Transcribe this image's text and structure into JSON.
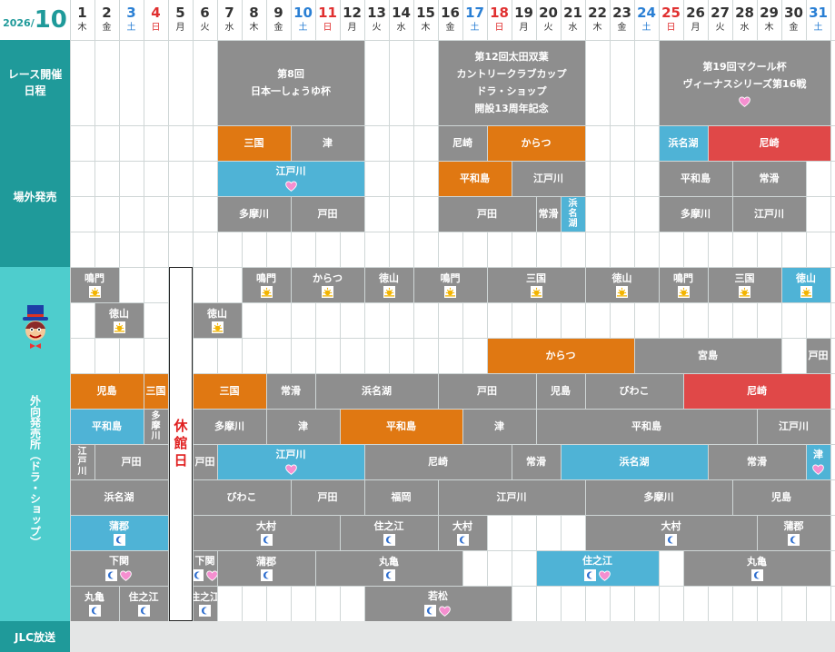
{
  "header": {
    "year": "2026/",
    "month": "10"
  },
  "days": [
    {
      "d": "1",
      "w": "木"
    },
    {
      "d": "2",
      "w": "金"
    },
    {
      "d": "3",
      "w": "土"
    },
    {
      "d": "4",
      "w": "日"
    },
    {
      "d": "5",
      "w": "月"
    },
    {
      "d": "6",
      "w": "火"
    },
    {
      "d": "7",
      "w": "水"
    },
    {
      "d": "8",
      "w": "木"
    },
    {
      "d": "9",
      "w": "金"
    },
    {
      "d": "10",
      "w": "土"
    },
    {
      "d": "11",
      "w": "日"
    },
    {
      "d": "12",
      "w": "月"
    },
    {
      "d": "13",
      "w": "火"
    },
    {
      "d": "14",
      "w": "水"
    },
    {
      "d": "15",
      "w": "木"
    },
    {
      "d": "16",
      "w": "金"
    },
    {
      "d": "17",
      "w": "土"
    },
    {
      "d": "18",
      "w": "日"
    },
    {
      "d": "19",
      "w": "月"
    },
    {
      "d": "20",
      "w": "火"
    },
    {
      "d": "21",
      "w": "水"
    },
    {
      "d": "22",
      "w": "木"
    },
    {
      "d": "23",
      "w": "金"
    },
    {
      "d": "24",
      "w": "土"
    },
    {
      "d": "25",
      "w": "日"
    },
    {
      "d": "26",
      "w": "月"
    },
    {
      "d": "27",
      "w": "火"
    },
    {
      "d": "28",
      "w": "水"
    },
    {
      "d": "29",
      "w": "木"
    },
    {
      "d": "30",
      "w": "金"
    },
    {
      "d": "31",
      "w": "土"
    }
  ],
  "sections": {
    "race": "レース開催日程",
    "offsite": "場外発売",
    "outside": "外向発売所（ドラ・ショップ）",
    "jlc": "JLC放送"
  },
  "closed_label": "休館日",
  "colors": {
    "header_teal": "#1f9a9a",
    "section_light": "#4ecdcd",
    "gray": "#8e8e8e",
    "orange": "#e07812",
    "blue": "#4fb3d6",
    "red": "#e04848",
    "saturday": "#2a7fd4",
    "sunday": "#e03030"
  },
  "race_events": [
    {
      "lines": [
        "第8回",
        "日本一しょうゆ杯"
      ],
      "icons": []
    },
    {
      "lines": [
        "第12回太田双葉",
        "カントリークラブカップ",
        "ドラ・ショップ",
        "開設13周年記念"
      ],
      "icons": []
    },
    {
      "lines": [
        "第19回マクール杯",
        "ヴィーナスシリーズ第16戦"
      ],
      "icons": [
        "heart-icon"
      ]
    }
  ],
  "offsite_blocks": [
    {
      "name": "三国",
      "icons": []
    },
    {
      "name": "津",
      "icons": []
    },
    {
      "name": "尼崎",
      "icons": []
    },
    {
      "name": "からつ",
      "icons": []
    },
    {
      "name": "浜名湖",
      "icons": []
    },
    {
      "name": "尼崎",
      "icons": []
    },
    {
      "name": "江戸川",
      "icons": [
        "heart-icon"
      ]
    },
    {
      "name": "平和島",
      "icons": []
    },
    {
      "name": "江戸川",
      "icons": []
    },
    {
      "name": "平和島",
      "icons": []
    },
    {
      "name": "常滑",
      "icons": []
    },
    {
      "name": "多摩川",
      "icons": []
    },
    {
      "name": "戸田",
      "icons": []
    },
    {
      "name": "戸田",
      "icons": []
    },
    {
      "name": "常滑",
      "icons": []
    },
    {
      "name": "浜名湖",
      "icons": []
    },
    {
      "name": "多摩川",
      "icons": []
    },
    {
      "name": "江戸川",
      "icons": []
    }
  ],
  "outside_blocks": [
    {
      "name": "鳴門",
      "icons": [
        "sun-icon"
      ]
    },
    {
      "name": "鳴門",
      "icons": [
        "sun-icon"
      ]
    },
    {
      "name": "からつ",
      "icons": [
        "sun-icon"
      ]
    },
    {
      "name": "徳山",
      "icons": [
        "sun-icon"
      ]
    },
    {
      "name": "鳴門",
      "icons": [
        "sun-icon"
      ]
    },
    {
      "name": "三国",
      "icons": [
        "sun-icon"
      ]
    },
    {
      "name": "徳山",
      "icons": [
        "sun-icon"
      ]
    },
    {
      "name": "鳴門",
      "icons": [
        "sun-icon"
      ]
    },
    {
      "name": "三国",
      "icons": [
        "sun-icon"
      ]
    },
    {
      "name": "徳山",
      "icons": [
        "sun-icon"
      ]
    },
    {
      "name": "徳山",
      "icons": [
        "sun-icon"
      ]
    },
    {
      "name": "徳山",
      "icons": [
        "sun-icon"
      ]
    },
    {
      "name": "からつ",
      "icons": []
    },
    {
      "name": "宮島",
      "icons": []
    },
    {
      "name": "戸田",
      "icons": []
    },
    {
      "name": "児島",
      "icons": []
    },
    {
      "name": "三国",
      "icons": []
    },
    {
      "name": "三国",
      "icons": []
    },
    {
      "name": "常滑",
      "icons": []
    },
    {
      "name": "浜名湖",
      "icons": []
    },
    {
      "name": "戸田",
      "icons": []
    },
    {
      "name": "児島",
      "icons": []
    },
    {
      "name": "びわこ",
      "icons": []
    },
    {
      "name": "尼崎",
      "icons": []
    },
    {
      "name": "平和島",
      "icons": []
    },
    {
      "name": "多摩川",
      "icons": []
    },
    {
      "name": "多摩川",
      "icons": []
    },
    {
      "name": "津",
      "icons": []
    },
    {
      "name": "平和島",
      "icons": []
    },
    {
      "name": "津",
      "icons": []
    },
    {
      "name": "平和島",
      "icons": []
    },
    {
      "name": "江戸川",
      "icons": []
    },
    {
      "name": "江戸川",
      "icons": []
    },
    {
      "name": "戸田",
      "icons": []
    },
    {
      "name": "戸田",
      "icons": []
    },
    {
      "name": "江戸川",
      "icons": [
        "heart-icon"
      ]
    },
    {
      "name": "尼崎",
      "icons": []
    },
    {
      "name": "常滑",
      "icons": []
    },
    {
      "name": "浜名湖",
      "icons": []
    },
    {
      "name": "常滑",
      "icons": []
    },
    {
      "name": "津",
      "icons": [
        "heart-icon"
      ]
    },
    {
      "name": "浜名湖",
      "icons": []
    },
    {
      "name": "びわこ",
      "icons": []
    },
    {
      "name": "戸田",
      "icons": []
    },
    {
      "name": "福岡",
      "icons": []
    },
    {
      "name": "江戸川",
      "icons": []
    },
    {
      "name": "多摩川",
      "icons": []
    },
    {
      "name": "児島",
      "icons": []
    },
    {
      "name": "蒲郡",
      "icons": [
        "moon-icon"
      ]
    },
    {
      "name": "大村",
      "icons": [
        "moon-icon"
      ]
    },
    {
      "name": "住之江",
      "icons": [
        "moon-icon"
      ]
    },
    {
      "name": "大村",
      "icons": [
        "moon-icon"
      ]
    },
    {
      "name": "大村",
      "icons": [
        "moon-icon"
      ]
    },
    {
      "name": "蒲郡",
      "icons": [
        "moon-icon"
      ]
    },
    {
      "name": "下関",
      "icons": [
        "moon-icon",
        "heart-icon"
      ]
    },
    {
      "name": "下関",
      "icons": [
        "moon-icon",
        "heart-icon"
      ]
    },
    {
      "name": "蒲郡",
      "icons": [
        "moon-icon"
      ]
    },
    {
      "name": "丸亀",
      "icons": [
        "moon-icon"
      ]
    },
    {
      "name": "住之江",
      "icons": [
        "moon-icon",
        "heart-icon"
      ]
    },
    {
      "name": "丸亀",
      "icons": [
        "moon-icon"
      ]
    },
    {
      "name": "丸亀",
      "icons": [
        "moon-icon"
      ]
    },
    {
      "name": "住之江",
      "icons": [
        "moon-icon"
      ]
    },
    {
      "name": "住之江",
      "icons": [
        "moon-icon"
      ]
    },
    {
      "name": "若松",
      "icons": [
        "moon-icon",
        "heart-icon"
      ]
    }
  ]
}
